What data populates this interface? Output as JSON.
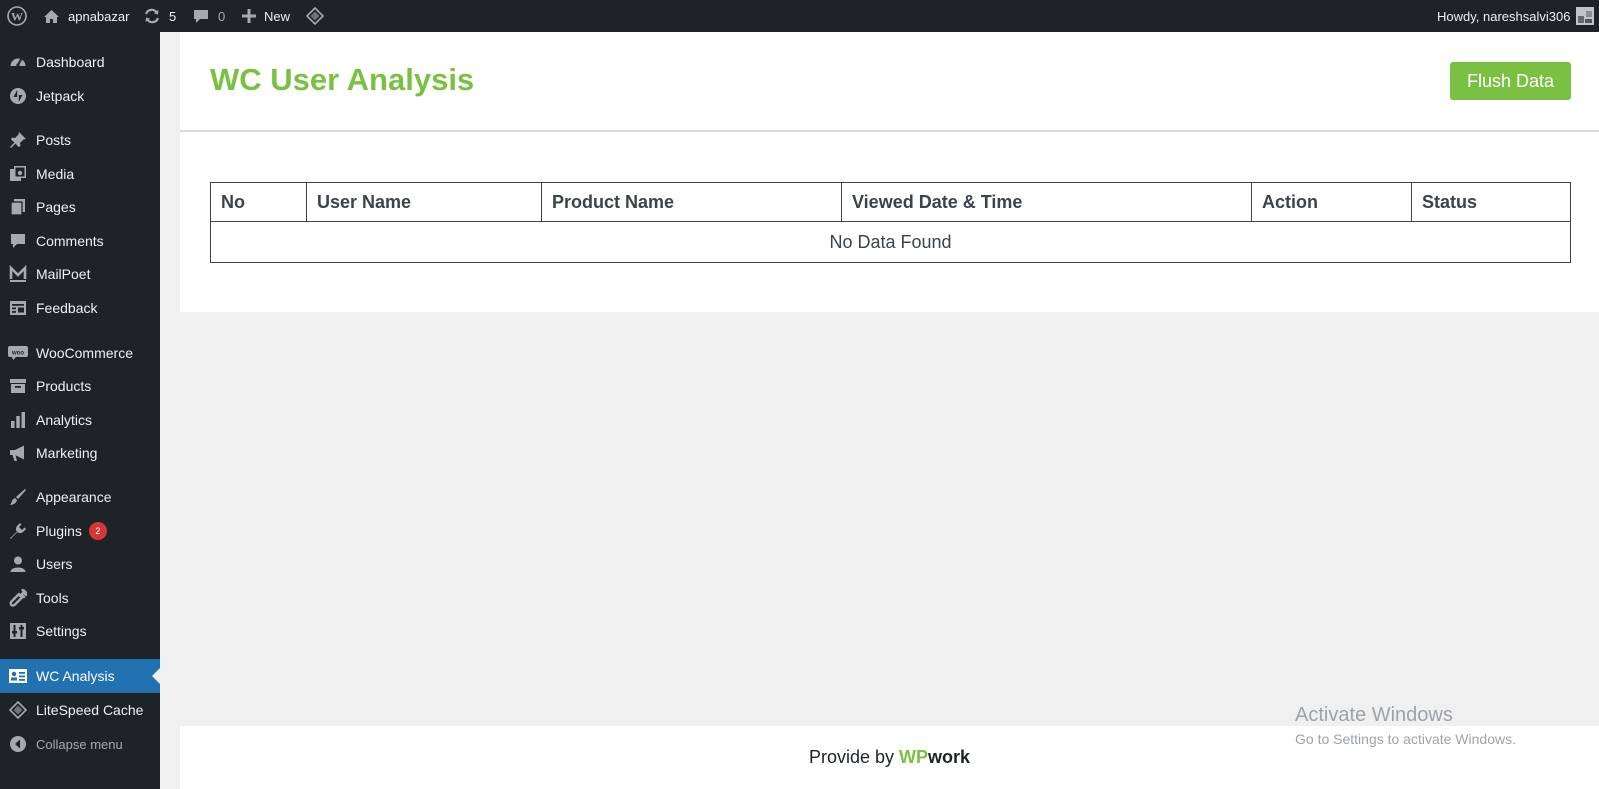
{
  "adminbar": {
    "site_name": "apnabazar",
    "updates_count": "5",
    "comments_count": "0",
    "new_label": "New",
    "howdy": "Howdy, nareshsalvi306",
    "icons": [
      "wordpress-logo-icon",
      "home-icon",
      "updates-icon",
      "comments-icon",
      "plus-icon",
      "litespeed-icon",
      "avatar"
    ]
  },
  "sidebar": {
    "items": [
      {
        "label": "Dashboard",
        "icon": "dashboard-icon"
      },
      {
        "label": "Jetpack",
        "icon": "jetpack-icon"
      },
      {
        "label": "Posts",
        "icon": "pin-icon"
      },
      {
        "label": "Media",
        "icon": "media-icon"
      },
      {
        "label": "Pages",
        "icon": "pages-icon"
      },
      {
        "label": "Comments",
        "icon": "comment-icon"
      },
      {
        "label": "MailPoet",
        "icon": "mailpoet-icon"
      },
      {
        "label": "Feedback",
        "icon": "feedback-icon"
      },
      {
        "label": "WooCommerce",
        "icon": "woo-icon"
      },
      {
        "label": "Products",
        "icon": "archive-icon"
      },
      {
        "label": "Analytics",
        "icon": "bar-chart-icon"
      },
      {
        "label": "Marketing",
        "icon": "megaphone-icon"
      },
      {
        "label": "Appearance",
        "icon": "brush-icon"
      },
      {
        "label": "Plugins",
        "icon": "plug-icon",
        "badge": "2"
      },
      {
        "label": "Users",
        "icon": "user-icon"
      },
      {
        "label": "Tools",
        "icon": "wrench-icon"
      },
      {
        "label": "Settings",
        "icon": "settings-icon"
      },
      {
        "label": "WC Analysis",
        "icon": "id-card-icon",
        "current": true
      },
      {
        "label": "LiteSpeed Cache",
        "icon": "litespeed-icon"
      },
      {
        "label": "Collapse menu",
        "icon": "collapse-icon"
      }
    ]
  },
  "main": {
    "title": "WC User Analysis",
    "flush_button": "Flush Data",
    "table": {
      "columns": [
        "No",
        "User Name",
        "Product Name",
        "Viewed Date & Time",
        "Action",
        "Status"
      ],
      "empty_message": "No Data Found"
    }
  },
  "footer": {
    "prefix": "Provide by",
    "brand_wp": "WP",
    "brand_work": "work"
  },
  "watermark": {
    "title": "Activate Windows",
    "subtitle": "Go to Settings to activate Windows."
  },
  "colors": {
    "accent_green": "#7ac143",
    "admin_dark": "#1d2327",
    "current_blue": "#2271b1",
    "badge_red": "#d63638"
  }
}
